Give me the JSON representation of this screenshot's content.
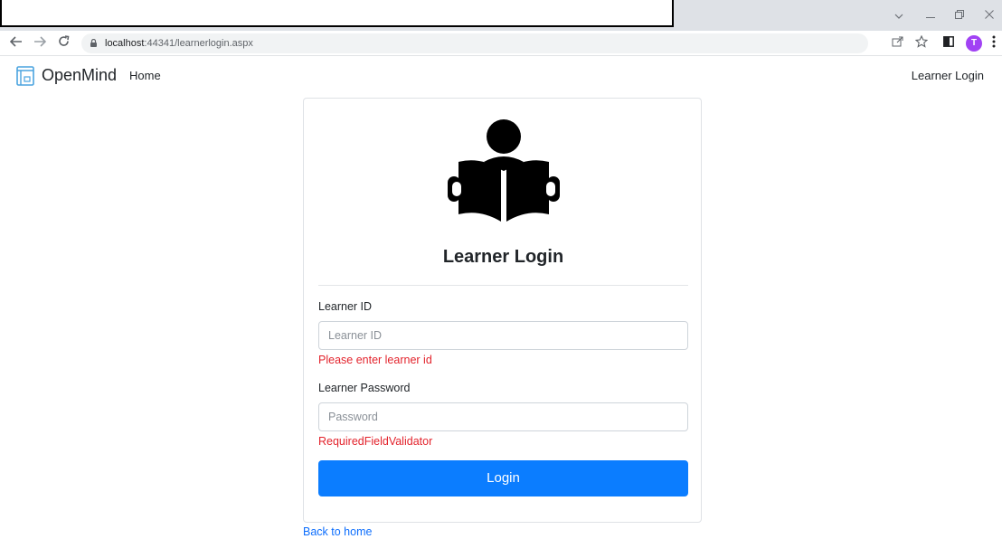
{
  "browser": {
    "url_host": "localhost",
    "url_rest": ":44341/learnerlogin.aspx",
    "profile_initial": "T"
  },
  "navbar": {
    "brand": "OpenMind",
    "home_link": "Home",
    "login_link": "Learner Login"
  },
  "card": {
    "title": "Learner Login",
    "learner_id": {
      "label": "Learner ID",
      "placeholder": "Learner ID",
      "value": "",
      "error": "Please enter learner id"
    },
    "password": {
      "label": "Learner Password",
      "placeholder": "Password",
      "value": "",
      "error": "RequiredFieldValidator"
    },
    "login_button": "Login"
  },
  "back_link": "Back to home",
  "colors": {
    "primary": "#0b7dff",
    "error": "#e3232c",
    "link": "#0d6efd"
  }
}
